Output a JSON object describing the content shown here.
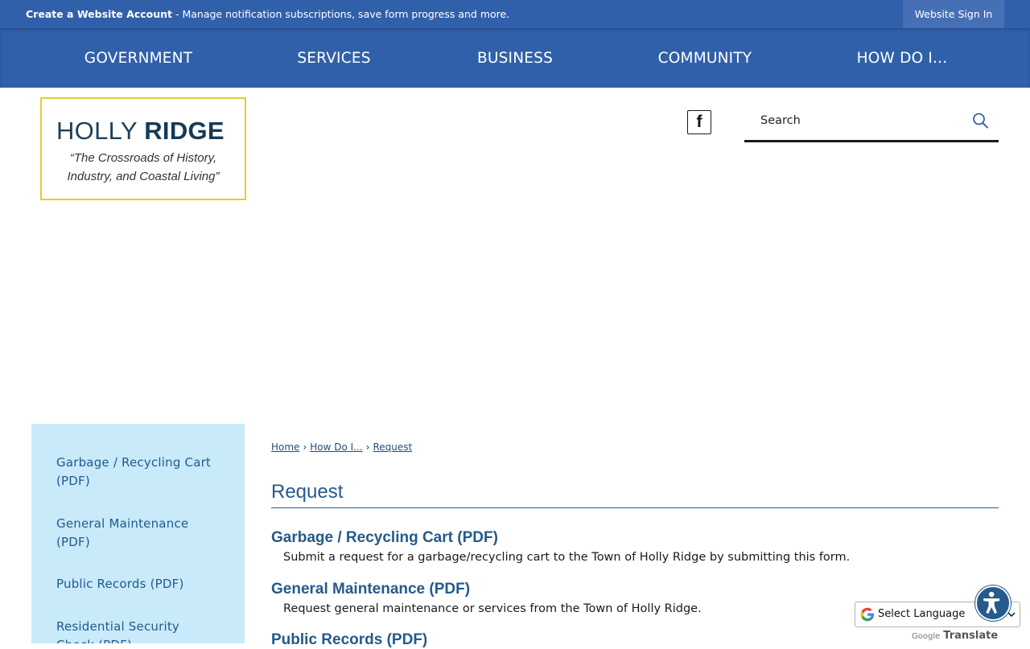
{
  "topbar": {
    "create_account": "Create a Website Account",
    "message": " - Manage notification subscriptions, save form progress and more.",
    "signin_label": "Website Sign In"
  },
  "nav": {
    "items": [
      {
        "label": "GOVERNMENT"
      },
      {
        "label": "SERVICES"
      },
      {
        "label": "BUSINESS"
      },
      {
        "label": "COMMUNITY"
      },
      {
        "label": "HOW DO I..."
      }
    ]
  },
  "logo": {
    "title_part1": "HOLLY ",
    "title_part2": "RIDGE",
    "tagline_line1": "“The Crossroads of History,",
    "tagline_line2": "Industry, and Coastal Living”",
    "border_color": "#e2cc35"
  },
  "social": {
    "facebook_glyph": "f",
    "icon": "facebook-icon"
  },
  "search": {
    "placeholder": "Search",
    "icon": "search-icon"
  },
  "sidebar": {
    "items": [
      {
        "label": "Garbage / Recycling Cart (PDF)"
      },
      {
        "label": "General Maintenance (PDF)"
      },
      {
        "label": "Public Records (PDF)"
      },
      {
        "label": "Residential Security Check (PDF)"
      }
    ]
  },
  "breadcrumb": {
    "home": "Home",
    "how_do_i": "How Do I...",
    "current": "Request",
    "separator": "›"
  },
  "main": {
    "title": "Request",
    "entries": [
      {
        "title": "Garbage / Recycling Cart (PDF)",
        "description": "Submit a request for a garbage/recycling cart to the Town of Holly Ridge by submitting this form."
      },
      {
        "title": "General Maintenance (PDF)",
        "description": "Request general maintenance or services from the Town of Holly Ridge."
      },
      {
        "title": "Public Records (PDF)",
        "description": ""
      }
    ]
  },
  "translate": {
    "select_label": "Select Language",
    "powered_google": "Google",
    "powered_translate": "Translate"
  },
  "accessibility": {
    "icon": "accessibility-icon"
  },
  "colors": {
    "brand_blue": "#3160ab",
    "link_blue": "#245a8c",
    "sidebar_bg": "#c8eaf9"
  }
}
